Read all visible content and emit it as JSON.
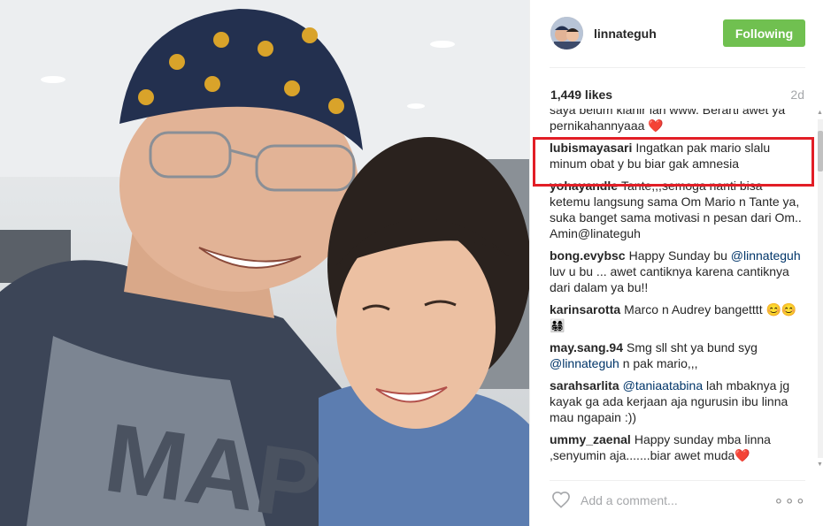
{
  "post": {
    "username": "linnateguh",
    "follow_label": "Following",
    "likes": "1,449 likes",
    "time": "2d",
    "comment_placeholder": "Add a comment...",
    "more_label": "∘∘∘"
  },
  "comments": [
    {
      "user": "",
      "text": "saya belum klanir lah www. Berarti awet ya pernikahannyaaa ❤️"
    },
    {
      "user": "lubismayasari",
      "text": "Ingatkan pak mario slalu minum obat y bu biar gak amnesia"
    },
    {
      "user": "yohayandle",
      "text": "Tante,,,semoga nanti bisa ketemu langsung sama Om Mario n Tante ya, suka banget sama motivasi n pesan dari Om.. Amin@linateguh"
    },
    {
      "user": "bong.evybsc",
      "text": "Happy Sunday bu",
      "mention": "@linnateguh",
      "text2": " luv u bu ... awet cantiknya karena cantiknya dari dalam ya bu!!"
    },
    {
      "user": "karinsarotta",
      "text": "Marco n Audrey bangetttt 😊😊 👨‍👩‍👧‍👦"
    },
    {
      "user": "may.sang.94",
      "text": "Smg sll sht ya bund syg",
      "mention": "@linnateguh",
      "text2": " n pak mario,,,"
    },
    {
      "user": "sarahsarlita",
      "text": "",
      "mention": "@taniaatabina",
      "text2": " lah mbaknya jg kayak ga ada kerjaan aja ngurusin ibu linna mau ngapain :))"
    },
    {
      "user": "ummy_zaenal",
      "text": "Happy sunday mba linna ,senyumin aja.......biar awet muda❤️"
    }
  ],
  "scroll": {
    "position": 0.04,
    "visible_fraction": 0.12
  },
  "colors": {
    "follow": "#70c050",
    "highlight": "#e21e26",
    "mention": "#003569"
  }
}
